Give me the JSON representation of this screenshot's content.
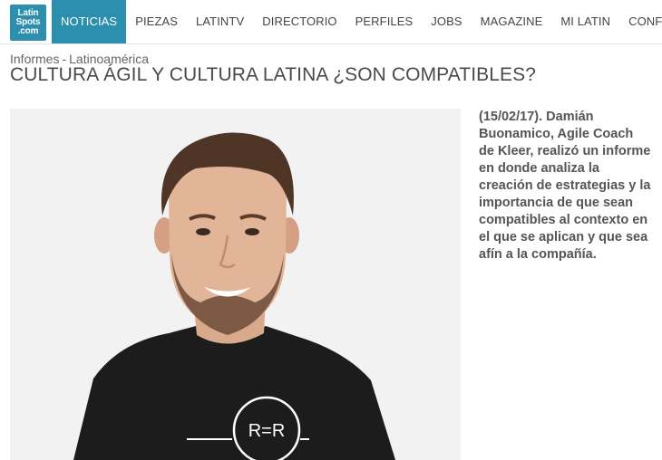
{
  "logo": {
    "line1": "Latin",
    "line2": "Spots",
    "line3": ".com"
  },
  "nav": {
    "items": [
      {
        "label": "NOTICIAS",
        "active": true
      },
      {
        "label": "PIEZAS"
      },
      {
        "label": "LATINTV"
      },
      {
        "label": "DIRECTORIO"
      },
      {
        "label": "PERFILES"
      },
      {
        "label": "JOBS"
      },
      {
        "label": "MAGAZINE"
      },
      {
        "label": "MI LATIN"
      },
      {
        "label": "CONFEREN"
      }
    ]
  },
  "article": {
    "category": "Informes",
    "separator": "-",
    "region": "Latinoamérica",
    "title": "CULTURA ÁGIL Y CULTURA LATINA ¿SON COMPATIBLES?",
    "summary": "(15/02/17). Damián Buonamico, Agile Coach de Kleer, realizó un informe en donde analiza la creación de estrategias y la importancia de que sean compatibles al contexto en el que se aplican y que sea afín a la compañía.",
    "photo_shirt_text": "R=R"
  },
  "colors": {
    "accent": "#2b8fad",
    "title": "#4a4a4a"
  }
}
